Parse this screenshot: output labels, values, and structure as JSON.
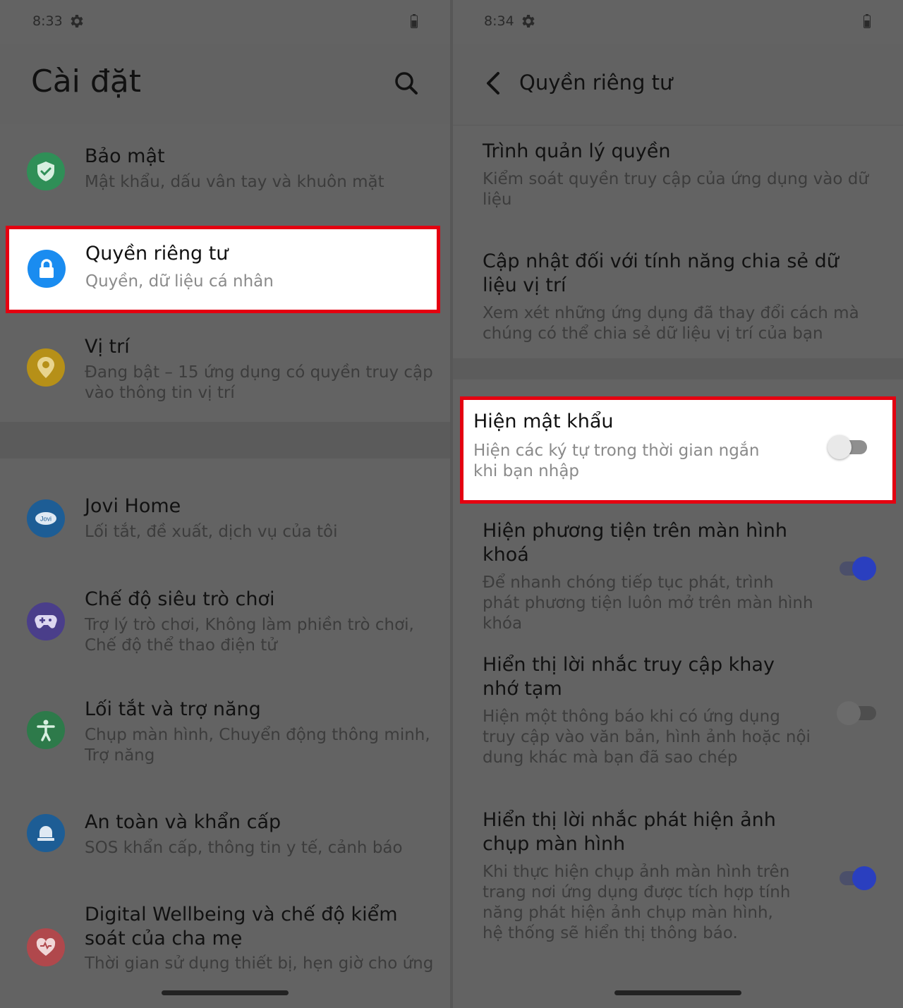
{
  "colors": {
    "accent": "#2a3fbf",
    "highlight_border": "#e40010",
    "security_icon": "#2f8f57",
    "privacy_icon": "#1a8cf0",
    "location_icon": "#b69018",
    "jovi_icon": "#1d5d95",
    "game_icon": "#4a3e8a",
    "shortcuts_icon": "#2d7a4a",
    "safety_icon": "#1d5d95",
    "wellbeing_icon": "#b0484c"
  },
  "left": {
    "status": {
      "time": "8:33"
    },
    "title": "Cài đặt",
    "items": [
      {
        "title": "Bảo mật",
        "sub": "Mật khẩu, dấu vân tay và khuôn mặt",
        "icon": "shield-check-icon"
      },
      {
        "title": "Quyền riêng tư",
        "sub": "Quyền, dữ liệu cá nhân",
        "icon": "lock-icon"
      },
      {
        "title": "Vị trí",
        "sub": "Đang bật – 15 ứng dụng có quyền truy cập vào thông tin vị trí",
        "icon": "location-pin-icon"
      },
      {
        "title": "Jovi Home",
        "sub": "Lối tắt, đề xuất, dịch vụ của tôi",
        "icon": "jovi-icon",
        "icon_text": "Jovi"
      },
      {
        "title": "Chế độ siêu trò chơi",
        "sub": "Trợ lý trò chơi, Không làm phiền trò chơi, Chế độ thể thao điện tử",
        "icon": "gamepad-icon"
      },
      {
        "title": "Lối tắt và trợ năng",
        "sub": "Chụp màn hình, Chuyển động thông minh, Trợ năng",
        "icon": "accessibility-icon"
      },
      {
        "title": "An toàn và khẩn cấp",
        "sub": "SOS khẩn cấp, thông tin y tế, cảnh báo",
        "icon": "emergency-bell-icon"
      },
      {
        "title": "Digital Wellbeing và chế độ kiểm soát của cha mẹ",
        "sub": "Thời gian sử dụng thiết bị, hẹn giờ cho ứng",
        "icon": "heart-icon"
      }
    ]
  },
  "right": {
    "status": {
      "time": "8:34"
    },
    "title": "Quyền riêng tư",
    "items": [
      {
        "title": "Trình quản lý quyền",
        "sub": "Kiểm soát quyền truy cập của ứng dụng vào dữ liệu"
      },
      {
        "title": "Cập nhật đối với tính năng chia sẻ dữ liệu vị trí",
        "sub": "Xem xét những ứng dụng đã thay đổi cách mà chúng có thể chia sẻ dữ liệu vị trí của bạn"
      },
      {
        "title": "Hiện mật khẩu",
        "sub": "Hiện các ký tự trong thời gian ngắn khi bạn nhập",
        "toggle_on": false
      },
      {
        "title": "Hiện phương tiện trên màn hình khoá",
        "sub": "Để nhanh chóng tiếp tục phát, trình phát phương tiện luôn mở trên màn hình khóa",
        "toggle_on": true
      },
      {
        "title": "Hiển thị lời nhắc truy cập khay nhớ tạm",
        "sub": "Hiện một thông báo khi có ứng dụng truy cập vào văn bản, hình ảnh hoặc nội dung khác mà bạn đã sao chép",
        "toggle_on": false
      },
      {
        "title": "Hiển thị lời nhắc phát hiện ảnh chụp màn hình",
        "sub": "Khi thực hiện chụp ảnh màn hình trên trang nơi ứng dụng được tích hợp tính năng phát hiện ảnh chụp màn hình, hệ thống sẽ hiển thị thông báo.",
        "toggle_on": true
      }
    ]
  }
}
